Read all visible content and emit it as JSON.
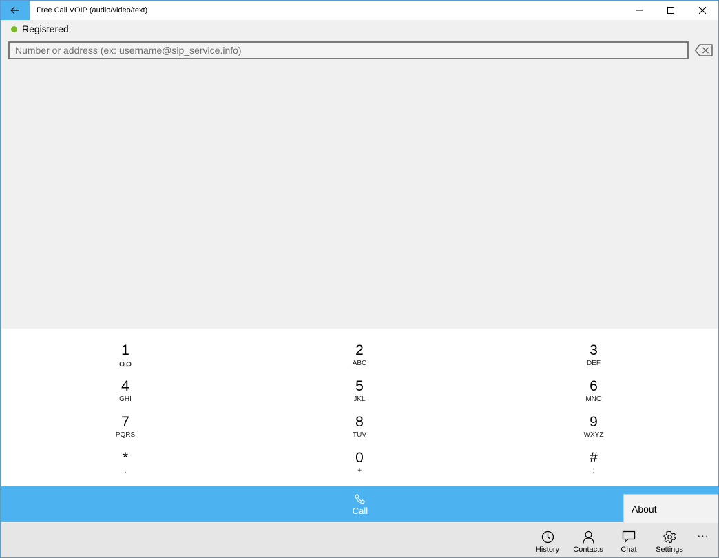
{
  "window": {
    "title": "Free Call VOIP (audio/video/text)"
  },
  "status": {
    "text": "Registered",
    "color": "#7cbb21"
  },
  "address": {
    "placeholder": "Number or address (ex: username@sip_service.info)",
    "value": ""
  },
  "dialpad": {
    "keys": [
      {
        "digit": "1",
        "sub": ""
      },
      {
        "digit": "2",
        "sub": "ABC"
      },
      {
        "digit": "3",
        "sub": "DEF"
      },
      {
        "digit": "4",
        "sub": "GHI"
      },
      {
        "digit": "5",
        "sub": "JKL"
      },
      {
        "digit": "6",
        "sub": "MNO"
      },
      {
        "digit": "7",
        "sub": "PQRS"
      },
      {
        "digit": "8",
        "sub": "TUV"
      },
      {
        "digit": "9",
        "sub": "WXYZ"
      },
      {
        "digit": "*",
        "sub": ","
      },
      {
        "digit": "0",
        "sub": "+"
      },
      {
        "digit": "#",
        "sub": ";"
      }
    ]
  },
  "call": {
    "label": "Call"
  },
  "menu": {
    "about": "About"
  },
  "appbar": {
    "history": "History",
    "contacts": "Contacts",
    "chat": "Chat",
    "settings": "Settings",
    "more": "···"
  },
  "colors": {
    "accent": "#4cb2f0",
    "background": "#f0f0f0"
  }
}
